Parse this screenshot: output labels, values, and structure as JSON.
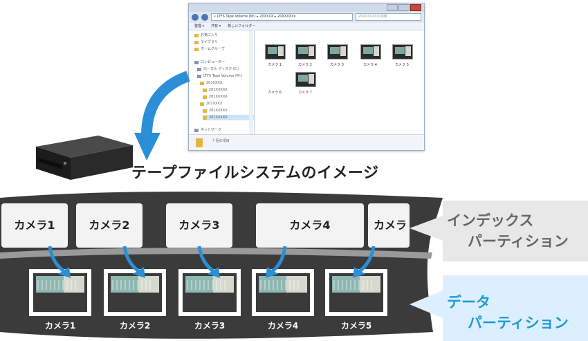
{
  "explorer": {
    "address": "« LTFS Tape Volume (M:) ▸ 20XXXX ▸ 20XXXXXx",
    "search_placeholder": "20XXXXXXの検索",
    "toolbar": [
      "整理 ▾",
      "共有 ▾",
      "新しいフォルダー"
    ],
    "nav_items": [
      {
        "label": "お気に入り",
        "icon": "star"
      },
      {
        "label": "ライブラリ",
        "icon": "library"
      },
      {
        "label": "ホームグループ",
        "icon": "homegroup"
      },
      {
        "label": "コンピューター",
        "icon": "computer"
      },
      {
        "label": "ローカル ディスク (C:)",
        "icon": "drive"
      },
      {
        "label": "LTFS Tape Volume (M:)",
        "icon": "drive"
      },
      {
        "label": "201XXXX",
        "icon": "folder"
      },
      {
        "label": "201XXXXX",
        "icon": "folder"
      },
      {
        "label": "201XXXXX",
        "icon": "folder"
      },
      {
        "label": "201XXXX",
        "icon": "folder"
      },
      {
        "label": "201XXXXX",
        "icon": "folder"
      },
      {
        "label": "201XXXXX",
        "icon": "folder"
      },
      {
        "label": "ネットワーク",
        "icon": "network"
      }
    ],
    "files": [
      "カメラ 1",
      "カメラ 2",
      "カメラ 3",
      "カメラ 4",
      "カメラ 5",
      "カメラ 6",
      "カメラ 7"
    ],
    "status": "7 個の項目"
  },
  "diagram_title": "テープファイルシステムのイメージ",
  "index_partition": {
    "boxes": [
      "カメラ1",
      "カメラ2",
      "カメラ3",
      "カメラ4",
      "カメラ"
    ],
    "label_line1": "インデックス",
    "label_line2": "パーティション"
  },
  "data_partition": {
    "items": [
      "カメラ1",
      "カメラ2",
      "カメラ3",
      "カメラ4",
      "カメラ5"
    ],
    "label_line1": "データ",
    "label_line2": "パーティション"
  },
  "colors": {
    "arrow_blue": "#2a8fd6",
    "index_label": "#666666",
    "data_label": "#1e9ad6",
    "tape": "#3b3b3b",
    "tape_edge": "#9a9a9a"
  }
}
